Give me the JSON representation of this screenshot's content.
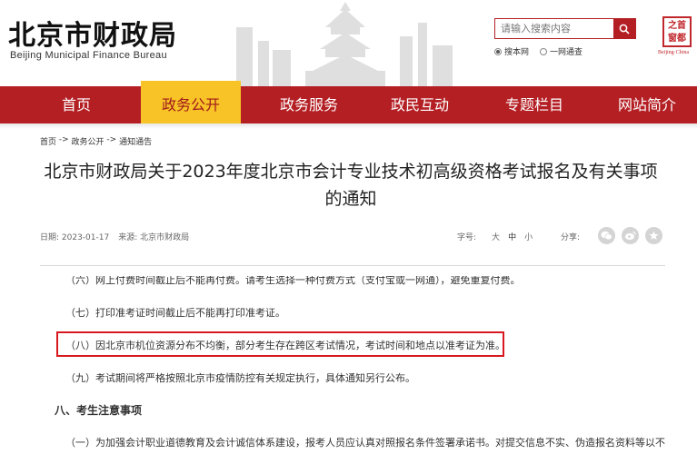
{
  "header": {
    "logo_cn": "北京市财政局",
    "logo_en": "Beijing Municipal Finance Bureau",
    "seal_chars": [
      "之",
      "首",
      "都",
      "窗"
    ],
    "seal_sub": "Beijing·China"
  },
  "search": {
    "placeholder": "请输入搜索内容",
    "options": [
      {
        "label": "搜本网",
        "selected": true
      },
      {
        "label": "一网通查",
        "selected": false
      }
    ]
  },
  "nav": {
    "items": [
      {
        "label": "首页",
        "active": false
      },
      {
        "label": "政务公开",
        "active": true
      },
      {
        "label": "政务服务",
        "active": false
      },
      {
        "label": "政民互动",
        "active": false
      },
      {
        "label": "专题栏目",
        "active": false
      },
      {
        "label": "网站简介",
        "active": false
      }
    ]
  },
  "breadcrumb": {
    "items": [
      "首页",
      "政务公开",
      "通知通告"
    ],
    "separator": " -> "
  },
  "article": {
    "title_line1": "北京市财政局关于2023年度北京市会计专业技术初高级资格考试报名及有关事项",
    "title_line2": "的通知",
    "date": "日期: 2023-01-17",
    "source": "来源: 北京市财政局",
    "font_size_label": "字号:",
    "font_sizes": [
      "大",
      "中",
      "小"
    ],
    "share_label": "分享:",
    "share_icons": [
      "wechat-icon",
      "weibo-icon",
      "star-icon"
    ],
    "paragraphs": {
      "p6": "（六）网上付费时间截止后不能再付费。请考生选择一种付费方式（支付宝或一网通），避免重复付费。",
      "p7": "（七）打印准考证时间截止后不能再打印准考证。",
      "p8": "（八）因北京市机位资源分布不均衡，部分考生存在跨区考试情况，考试时间和地点以准考证为准。",
      "p9": "（九）考试期间将严格按照北京市疫情防控有关规定执行，具体通知另行公布。",
      "section8": "八、考生注意事项",
      "p10": "（一）为加强会计职业道德教育及会计诚信体系建设，报考人员应认真对照报名条件签署承诺书。对提交信息不实、伪造报名资料等以不"
    }
  },
  "colors": {
    "brand_red": "#b41f24",
    "nav_active": "#f7c326",
    "highlight": "#d7191f"
  }
}
